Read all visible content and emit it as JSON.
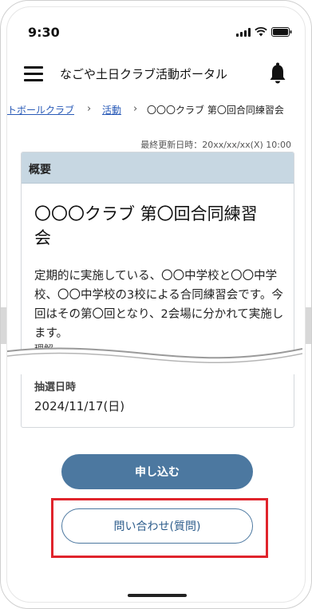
{
  "status_bar": {
    "time": "9:30"
  },
  "header": {
    "title": "なごや土日クラブ活動ポータル",
    "menu_icon": "hamburger-menu-icon",
    "notification_icon": "bell-icon"
  },
  "breadcrumb": {
    "items": [
      "トボールクラブ",
      "活動"
    ],
    "current": "〇〇〇クラブ 第〇回合同練習会"
  },
  "last_updated": "最終更新日時：20xx/xx/xx(X) 10:00",
  "card": {
    "header_label": "概要",
    "title": "〇〇〇クラブ 第〇回合同練習会",
    "description": "定期的に実施している、〇〇中学校と〇〇中学校、〇〇中学校の3校による合同練習会です。今回はその第〇回となり、2会場に分かれて実施します。",
    "truncated_text": "理解",
    "lottery_label": "抽選日時",
    "lottery_value": "2024/11/17(日)"
  },
  "actions": {
    "apply_label": "申し込む",
    "inquiry_label": "問い合わせ(質問)"
  },
  "colors": {
    "primary": "#4c78a0",
    "card_header": "#c7d7e2",
    "highlight": "#e0242c",
    "link": "#2a5bb8"
  }
}
